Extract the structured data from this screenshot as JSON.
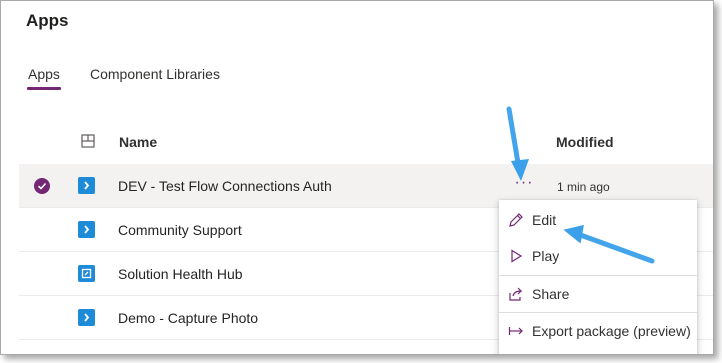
{
  "page": {
    "title": "Apps"
  },
  "tabs": [
    {
      "label": "Apps",
      "active": true
    },
    {
      "label": "Component Libraries",
      "active": false
    }
  ],
  "table": {
    "columns": {
      "name": "Name",
      "modified": "Modified"
    },
    "rows": [
      {
        "name": "DEV - Test Flow Connections Auth",
        "modified": "1 min ago",
        "selected": true,
        "icon": "canvas-app-icon",
        "more": "···"
      },
      {
        "name": "Community Support",
        "modified": "",
        "selected": false,
        "icon": "canvas-app-icon"
      },
      {
        "name": "Solution Health Hub",
        "modified": "",
        "selected": false,
        "icon": "model-driven-app-icon"
      },
      {
        "name": "Demo - Capture Photo",
        "modified": "",
        "selected": false,
        "icon": "canvas-app-icon"
      }
    ]
  },
  "context_menu": {
    "items": [
      {
        "label": "Edit",
        "icon": "pencil-icon"
      },
      {
        "label": "Play",
        "icon": "play-icon"
      },
      {
        "label": "Share",
        "icon": "share-icon"
      },
      {
        "label": "Export package (preview)",
        "icon": "export-icon"
      }
    ]
  },
  "colors": {
    "accent": "#742774",
    "app_icon": "#1e8bd8",
    "annotation_arrow": "#3aa0ea",
    "selected_row": "#f3f2f1"
  }
}
